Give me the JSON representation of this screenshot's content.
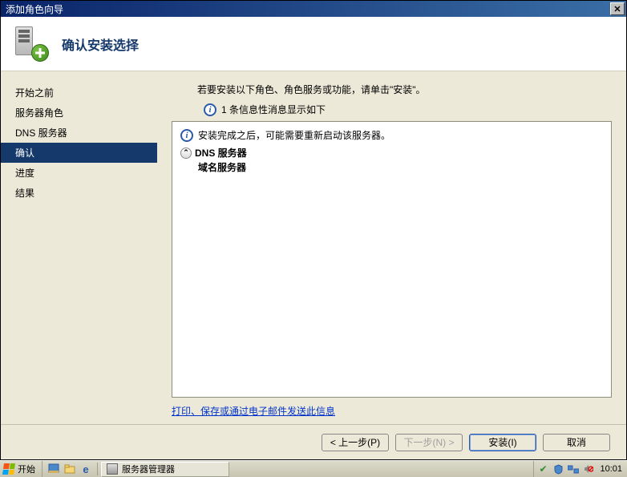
{
  "window": {
    "title": "添加角色向导"
  },
  "header": {
    "title": "确认安装选择"
  },
  "sidebar": {
    "items": [
      {
        "label": "开始之前"
      },
      {
        "label": "服务器角色"
      },
      {
        "label": "DNS 服务器"
      },
      {
        "label": "确认",
        "active": true
      },
      {
        "label": "进度"
      },
      {
        "label": "结果"
      }
    ]
  },
  "content": {
    "intro": "若要安装以下角色、角色服务或功能，请单击\"安装\"。",
    "info_count_line": "1 条信息性消息显示如下",
    "restart_message": "安装完成之后，可能需要重新启动该服务器。",
    "role_name": "DNS 服务器",
    "role_desc": "域名服务器",
    "link": "打印、保存或通过电子邮件发送此信息"
  },
  "footer": {
    "prev": "< 上一步(P)",
    "next": "下一步(N) >",
    "install": "安装(I)",
    "cancel": "取消"
  },
  "taskbar": {
    "start": "开始",
    "task1": "服务器管理器",
    "clock": "10:01"
  }
}
